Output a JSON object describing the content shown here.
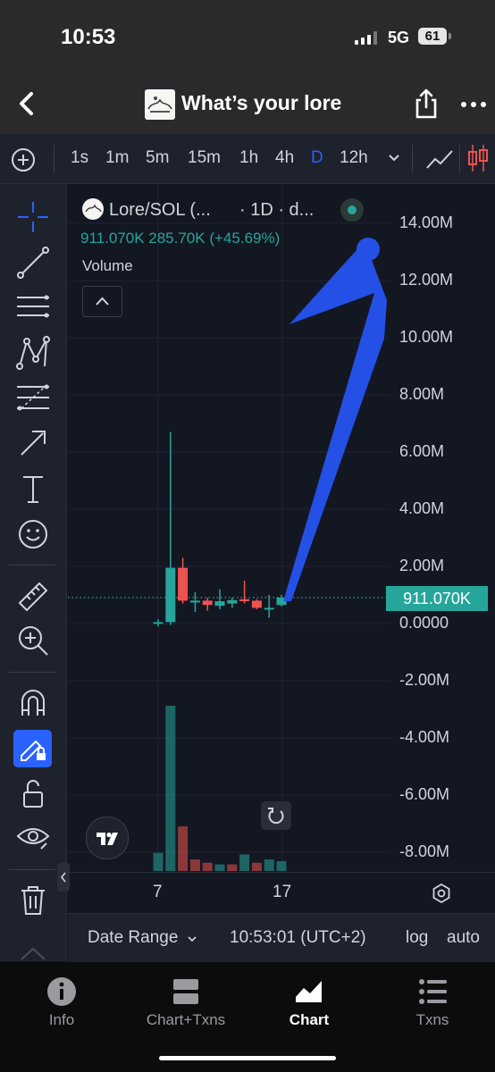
{
  "status_bar": {
    "time": "10:53",
    "network": "5G",
    "battery": "61"
  },
  "header": {
    "title": "What’s your lore",
    "back_icon": "chevron-left-icon",
    "share_icon": "share-icon",
    "more_icon": "ellipsis-icon"
  },
  "intervals": {
    "items": [
      "1s",
      "1m",
      "5m",
      "15m",
      "1h",
      "4h",
      "D",
      "12h"
    ],
    "active": "D"
  },
  "legend": {
    "symbol": "Lore/SOL (...",
    "interval": "· 1D · d...",
    "open_value": "911.070K",
    "change_abs": "285.70K",
    "change_pct": "(+45.69%)",
    "volume_label": "Volume"
  },
  "price_axis": {
    "labels": [
      "14.00M",
      "12.00M",
      "10.00M",
      "8.00M",
      "6.00M",
      "4.00M",
      "2.00M",
      "0.0000",
      "-2.00M",
      "-4.00M",
      "-6.00M",
      "-8.00M"
    ],
    "last_price": "911.070K"
  },
  "time_axis": {
    "labels": [
      "7",
      "17"
    ]
  },
  "bottom_bar": {
    "date_range": "Date Range",
    "clock": "10:53:01 (UTC+2)",
    "log": "log",
    "auto": "auto"
  },
  "tabs": [
    {
      "label": "Info",
      "icon": "info-icon"
    },
    {
      "label": "Chart+Txns",
      "icon": "split-view-icon"
    },
    {
      "label": "Chart",
      "icon": "area-chart-icon"
    },
    {
      "label": "Txns",
      "icon": "list-icon"
    }
  ],
  "active_tab": "Chart",
  "colors": {
    "up": "#26a69a",
    "down": "#ef5350",
    "accent": "#2962ff",
    "arrow": "#2450e6"
  },
  "chart_data": {
    "type": "candlestick",
    "ylim": [
      -9000000,
      15000000
    ],
    "candles": [
      {
        "o": 0,
        "h": 150000,
        "l": -100000,
        "c": 50000
      },
      {
        "o": 50000,
        "h": 6700000,
        "l": -50000,
        "c": 1950000
      },
      {
        "o": 1950000,
        "h": 2300000,
        "l": 700000,
        "c": 800000
      },
      {
        "o": 750000,
        "h": 1100000,
        "l": 400000,
        "c": 800000
      },
      {
        "o": 800000,
        "h": 900000,
        "l": 450000,
        "c": 650000
      },
      {
        "o": 620000,
        "h": 1200000,
        "l": 500000,
        "c": 780000
      },
      {
        "o": 700000,
        "h": 900000,
        "l": 550000,
        "c": 820000
      },
      {
        "o": 850000,
        "h": 1500000,
        "l": 700000,
        "c": 780000
      },
      {
        "o": 800000,
        "h": 850000,
        "l": 500000,
        "c": 550000
      },
      {
        "o": 500000,
        "h": 1000000,
        "l": 200000,
        "c": 550000
      },
      {
        "o": 650000,
        "h": 1000000,
        "l": 600000,
        "c": 911070
      }
    ],
    "volume": [
      {
        "v": 0.11,
        "up": true
      },
      {
        "v": 1.0,
        "up": true
      },
      {
        "v": 0.27,
        "up": false
      },
      {
        "v": 0.07,
        "up": false
      },
      {
        "v": 0.05,
        "up": false
      },
      {
        "v": 0.04,
        "up": true
      },
      {
        "v": 0.04,
        "up": false
      },
      {
        "v": 0.1,
        "up": true
      },
      {
        "v": 0.05,
        "up": false
      },
      {
        "v": 0.07,
        "up": true
      },
      {
        "v": 0.06,
        "up": true
      }
    ],
    "last_price": 911070,
    "annotation": "upward-arrow"
  }
}
